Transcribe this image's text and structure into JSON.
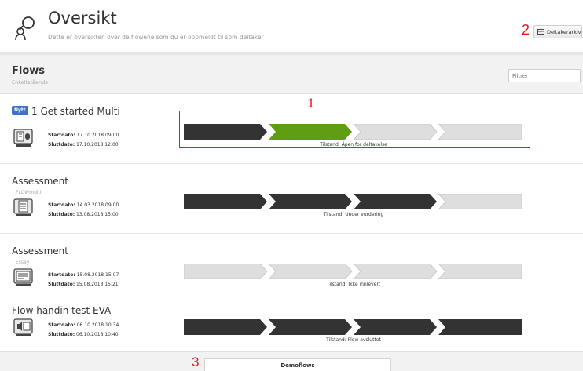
{
  "header": {
    "title": "Oversikt",
    "subtitle": "Dette er oversikten over de flowene som du er oppmeldt til som deltaker",
    "archive_button": "Deltakerarkiv"
  },
  "annotations": {
    "one": "1",
    "two": "2",
    "three": "3"
  },
  "flows_bar": {
    "title": "Flows",
    "subtitle": "Enkeltstående",
    "filter_placeholder": "Filtrer"
  },
  "step_colors": {
    "done": "#333333",
    "active": "#5f9e12",
    "pending": "#dedede"
  },
  "rows": [
    {
      "badge": "Nytt",
      "title": "1 Get started Multi",
      "subtitle": "",
      "icon": "document-icon",
      "start_label": "Startdato:",
      "start": "17.10.2018 09:00",
      "end_label": "Sluttdato:",
      "end": "17.10.2018 12:00",
      "steps": [
        "done",
        "active",
        "pending",
        "pending"
      ],
      "state": "Tilstand: Åpen for deltakelse"
    },
    {
      "badge": "",
      "title": "Assessment",
      "subtitle": "FLOWmulti",
      "icon": "document-icon",
      "start_label": "Startdato:",
      "start": "14.03.2018 09:00",
      "end_label": "Sluttdato:",
      "end": "13.08.2018 15:00",
      "steps": [
        "done",
        "done",
        "done",
        "pending"
      ],
      "state": "Tilstand: Under vurdering"
    },
    {
      "badge": "",
      "title": "Assessment",
      "subtitle": "Essay",
      "icon": "essay-icon",
      "start_label": "Startdato:",
      "start": "15.08.2018 15:07",
      "end_label": "Sluttdato:",
      "end": "15.08.2018 15:21",
      "steps": [
        "pending",
        "pending",
        "pending",
        "pending"
      ],
      "state": "Tilstand: Ikke innlevert"
    },
    {
      "badge": "",
      "title": "Flow handin test EVA",
      "subtitle": "",
      "icon": "media-icon",
      "start_label": "Startdato:",
      "start": "06.10.2018 10:34",
      "end_label": "Sluttdato:",
      "end": "06.10.2018 10:40",
      "steps": [
        "done",
        "done",
        "done",
        "done"
      ],
      "state": "Tilstand: Flow avsluttet"
    }
  ],
  "footer": {
    "demo_button": "Demoflows"
  }
}
